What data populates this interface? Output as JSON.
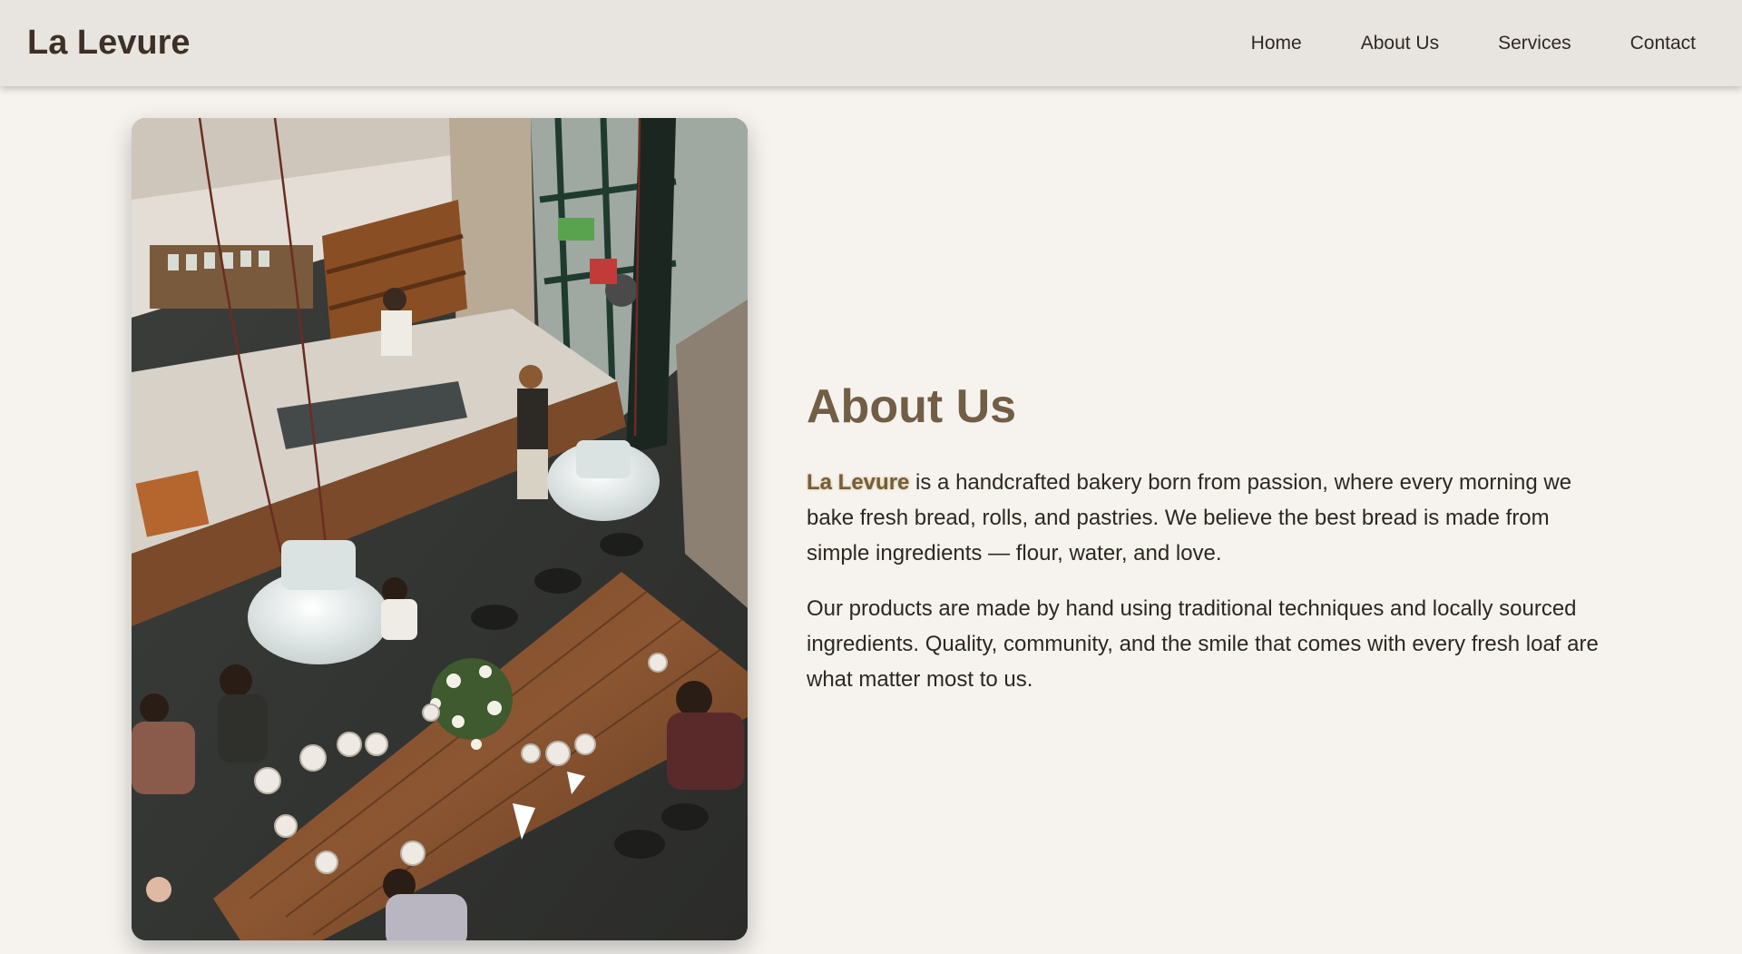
{
  "header": {
    "brand": "La Levure",
    "nav": [
      {
        "label": "Home"
      },
      {
        "label": "About Us"
      },
      {
        "label": "Services"
      },
      {
        "label": "Contact"
      }
    ]
  },
  "about": {
    "title": "About Us",
    "highlight": "La Levure",
    "paragraph1_rest": " is a handcrafted bakery born from passion, where every morning we bake fresh bread, rolls, and pastries. We believe the best bread is made from simple ingredients — flour, water, and love.",
    "paragraph2": "Our products are made by hand using traditional techniques and locally sourced ingredients. Quality, community, and the smile that comes with every fresh loaf are what matter most to us."
  },
  "colors": {
    "background": "#f6f3ef",
    "navbar": "#e8e4df",
    "accent": "#725e45",
    "text": "#2e2720"
  }
}
